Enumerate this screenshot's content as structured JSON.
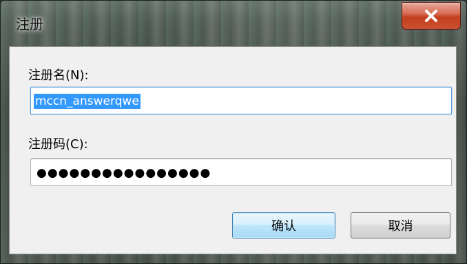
{
  "window": {
    "title": "注册",
    "close_icon": "close-x-icon"
  },
  "form": {
    "name_label": "注册名(N):",
    "name_value": "mccn_answerqwe",
    "code_label": "注册码(C):",
    "code_value_masked": "●●●●●●●●●●●●●●●●"
  },
  "buttons": {
    "ok_label": "确认",
    "cancel_label": "取消"
  },
  "colors": {
    "selection": "#3399ff",
    "close_button": "#c4401f",
    "default_button_border": "#3c7fb1"
  }
}
